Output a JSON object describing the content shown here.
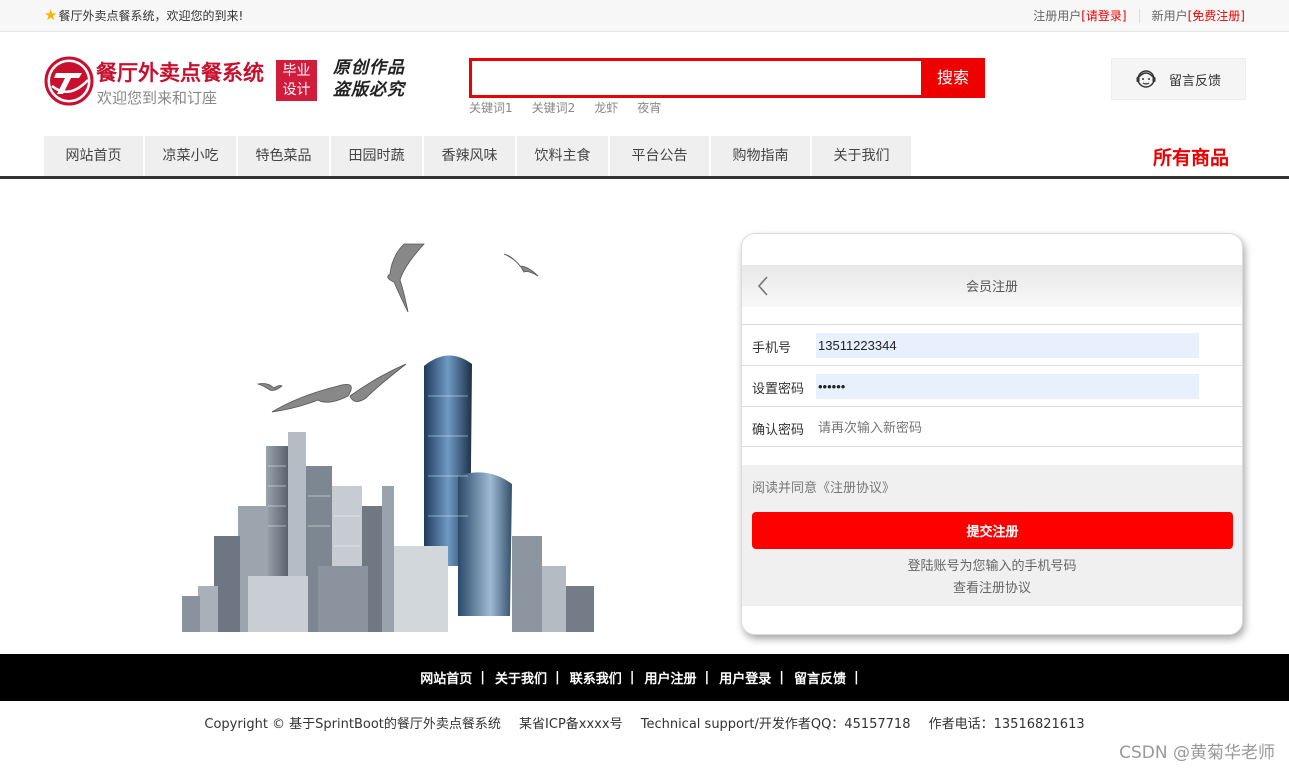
{
  "topbar": {
    "welcome": "餐厅外卖点餐系统，欢迎您的到来!",
    "registered_label": "注册用户",
    "login_link": "[请登录]",
    "new_user_label": "新用户",
    "register_link": "[免费注册]"
  },
  "header": {
    "site_title": "餐厅外卖点餐系统",
    "site_subtitle": "欢迎您到来和订座",
    "badge_line1": "毕业",
    "badge_line2": "设计",
    "slogan_line1": "原创作品",
    "slogan_line2": "盗版必究",
    "feedback_label": "留言反馈"
  },
  "search": {
    "placeholder": "",
    "button_label": "搜索",
    "keywords": [
      "关键词1",
      "关键词2",
      "龙虾",
      "夜宵"
    ]
  },
  "nav": {
    "items": [
      "网站首页",
      "凉菜小吃",
      "特色菜品",
      "田园时蔬",
      "香辣风味",
      "饮料主食",
      "平台公告",
      "购物指南",
      "关于我们"
    ],
    "all_goods": "所有商品"
  },
  "register": {
    "title": "会员注册",
    "phone_label": "手机号",
    "phone_value": "13511223344",
    "password_label": "设置密码",
    "password_value": "••••••",
    "confirm_label": "确认密码",
    "confirm_placeholder": "请再次输入新密码",
    "agree_text": "阅读并同意《注册协议》",
    "submit_label": "提交注册",
    "hint_account": "登陆账号为您输入的手机号码",
    "view_agreement": "查看注册协议"
  },
  "footer": {
    "links": [
      "网站首页",
      "关于我们",
      "联系我们",
      "用户注册",
      "用户登录",
      "留言反馈"
    ],
    "separator": "|",
    "copyright": "Copyright © 基于SprintBoot的餐厅外卖点餐系统",
    "icp": "某省ICP备xxxx号",
    "support": "Technical support/开发作者QQ：45157718",
    "phone": "作者电话：13516821613"
  },
  "watermark": "CSDN @黄菊华老师",
  "colors": {
    "accent": "#e00000",
    "brand": "#c8102e",
    "footer_bg": "#000000"
  }
}
